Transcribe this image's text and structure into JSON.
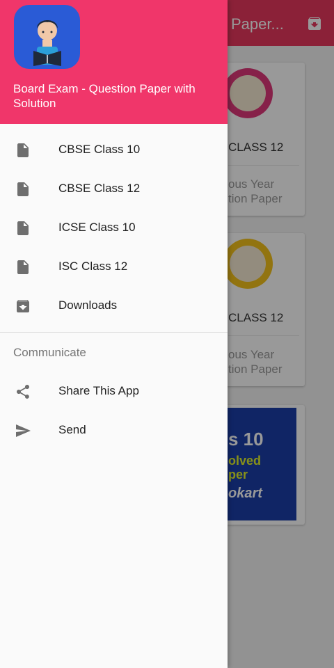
{
  "background": {
    "toolbar_title": "Paper...",
    "cards": [
      {
        "title": "CLASS 12",
        "subtitle_line1": "ous Year",
        "subtitle_line2": "tion Paper"
      },
      {
        "title": "CLASS 12",
        "subtitle_line1": "ous Year",
        "subtitle_line2": "tion Paper"
      }
    ],
    "banner": {
      "line1": "s 10",
      "line2": "olved",
      "line3": "per",
      "line4": "okart"
    }
  },
  "drawer": {
    "header_title": "Board Exam - Question Paper with Solution",
    "items": [
      {
        "label": "CBSE Class 10",
        "icon": "file-icon"
      },
      {
        "label": "CBSE Class 12",
        "icon": "file-icon"
      },
      {
        "label": "ICSE Class 10",
        "icon": "file-icon"
      },
      {
        "label": "ISC Class 12",
        "icon": "file-icon"
      },
      {
        "label": "Downloads",
        "icon": "download-box-icon"
      }
    ],
    "communicate_header": "Communicate",
    "communicate_items": [
      {
        "label": "Share This App",
        "icon": "share-icon"
      },
      {
        "label": "Send",
        "icon": "send-icon"
      }
    ]
  },
  "colors": {
    "accent": "#f0366a",
    "drawer_background": "#fafafa",
    "icon": "#6e6e6e"
  }
}
